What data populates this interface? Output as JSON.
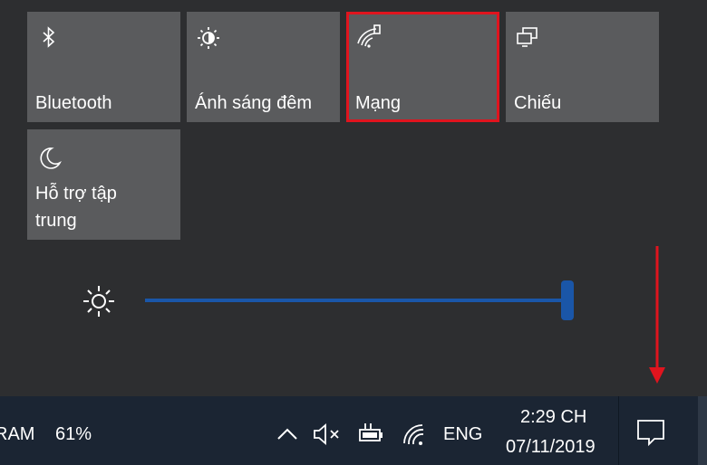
{
  "quick_actions": {
    "tiles": [
      {
        "label": "Bluetooth",
        "icon": "bluetooth-icon"
      },
      {
        "label": "Ánh sáng đêm",
        "icon": "night-light-icon"
      },
      {
        "label": "Mạng",
        "icon": "network-icon"
      },
      {
        "label": "Chiếu",
        "icon": "project-icon"
      },
      {
        "label_line1": "Hỗ trợ tập",
        "label_line2": "trung",
        "icon": "focus-assist-moon-icon"
      }
    ]
  },
  "brightness": {
    "icon": "brightness-sun-icon",
    "level_percent": 100
  },
  "taskbar": {
    "ram_label": "RAM",
    "ram_value": "61%",
    "time": "2:29 CH",
    "date": "07/11/2019",
    "language": "ENG",
    "icons": [
      "chevron-up-icon",
      "volume-muted-icon",
      "battery-charging-icon",
      "wifi-icon",
      "notification-icon"
    ]
  },
  "colors": {
    "tile_bg": "#5a5b5d",
    "highlight": "#e0141e",
    "slider": "#1a56a8",
    "taskbar_bg": "#1b2533"
  }
}
